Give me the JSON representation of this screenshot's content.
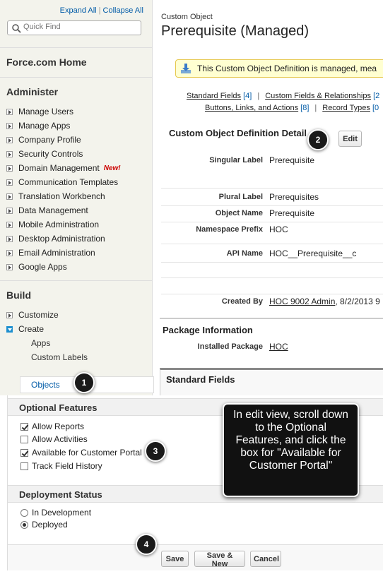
{
  "sidebar": {
    "expand_all": "Expand All",
    "separator": "|",
    "collapse_all": "Collapse All",
    "quick_find_placeholder": "Quick Find",
    "home": "Force.com Home",
    "administer": {
      "heading": "Administer",
      "items": [
        "Manage Users",
        "Manage Apps",
        "Company Profile",
        "Security Controls",
        "Domain Management",
        "Communication Templates",
        "Translation Workbench",
        "Data Management",
        "Mobile Administration",
        "Desktop Administration",
        "Email Administration",
        "Google Apps"
      ],
      "new_badge": "New!"
    },
    "build": {
      "heading": "Build",
      "customize": "Customize",
      "create": "Create",
      "sub_items": [
        "Apps",
        "Custom Labels"
      ],
      "objects": "Objects"
    }
  },
  "main": {
    "object_label": "Custom Object",
    "title": "Prerequisite (Managed)",
    "managed_message": "This Custom Object Definition is managed, mea",
    "related_links": {
      "standard_fields": "Standard Fields",
      "standard_fields_count": "[4]",
      "custom_fields": "Custom Fields & Relationships",
      "custom_fields_count": "[2",
      "buttons_links": "Buttons, Links, and Actions",
      "buttons_links_count": "[8]",
      "record_types": "Record Types",
      "record_types_count": "[0",
      "sep": "|"
    },
    "detail_title": "Custom Object Definition Detail",
    "edit_label": "Edit",
    "fields": {
      "singular_label": {
        "label": "Singular Label",
        "value": "Prerequisite"
      },
      "plural_label": {
        "label": "Plural Label",
        "value": "Prerequisites"
      },
      "object_name": {
        "label": "Object Name",
        "value": "Prerequisite"
      },
      "namespace_prefix": {
        "label": "Namespace Prefix",
        "value": "HOC"
      },
      "api_name": {
        "label": "API Name",
        "value": "HOC__Prerequisite__c"
      },
      "created_by": {
        "label": "Created By",
        "link": "HOC 9002 Admin",
        "date": ", 8/2/2013 9"
      }
    },
    "package_info": {
      "heading": "Package Information",
      "installed_label": "Installed Package",
      "installed_value": "HOC"
    },
    "standard_fields_heading": "Standard Fields"
  },
  "edit_panel": {
    "optional_features": {
      "heading": "Optional Features",
      "options": [
        {
          "label": "Allow Reports",
          "checked": true
        },
        {
          "label": "Allow Activities",
          "checked": false
        },
        {
          "label": "Available for Customer Portal",
          "checked": true
        },
        {
          "label": "Track Field History",
          "checked": false
        }
      ]
    },
    "deployment_status": {
      "heading": "Deployment Status",
      "options": [
        {
          "label": "In Development",
          "selected": false
        },
        {
          "label": "Deployed",
          "selected": true
        }
      ]
    },
    "buttons": {
      "save": "Save",
      "save_new": "Save & New",
      "cancel": "Cancel"
    }
  },
  "callouts": {
    "step1": "1",
    "step2": "2",
    "step3": "3",
    "step4": "4",
    "tooltip": "In edit view, scroll down to the Optional Features, and click the box for \"Available for Customer Portal\""
  }
}
